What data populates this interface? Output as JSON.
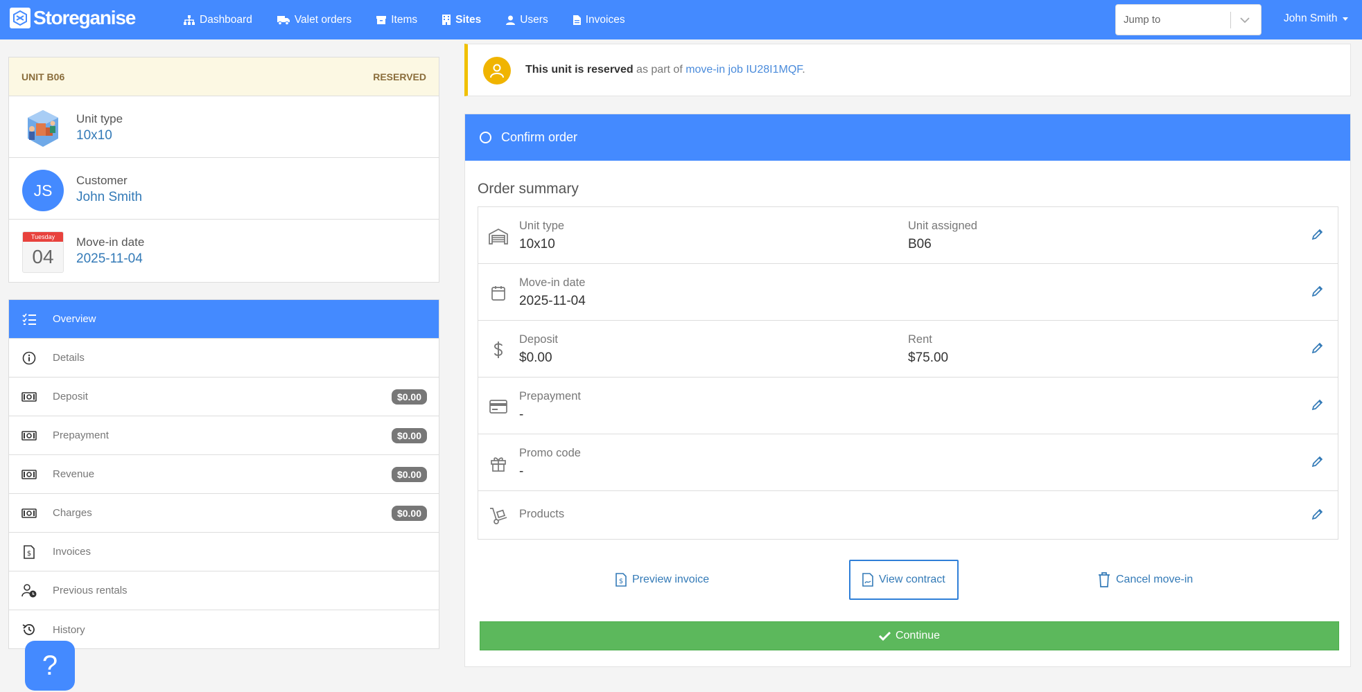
{
  "navbar": {
    "brand": "Storeganise",
    "links": [
      {
        "label": "Dashboard",
        "icon": "sitemap-icon"
      },
      {
        "label": "Valet orders",
        "icon": "truck-icon"
      },
      {
        "label": "Items",
        "icon": "archive-icon"
      },
      {
        "label": "Sites",
        "icon": "building-icon",
        "active": true
      },
      {
        "label": "Users",
        "icon": "user-icon"
      },
      {
        "label": "Invoices",
        "icon": "invoice-icon"
      }
    ],
    "jump_to": "Jump to",
    "user_name": "John Smith"
  },
  "unit_card": {
    "unit_label": "UNIT B06",
    "status": "RESERVED",
    "unit_type_label": "Unit type",
    "unit_type_value": "10x10",
    "customer_label": "Customer",
    "customer_initials": "JS",
    "customer_value": "John Smith",
    "move_in_label": "Move-in date",
    "move_in_value": "2025-11-04",
    "calendar_weekday": "Tuesday",
    "calendar_day": "04"
  },
  "side_menu": {
    "items": [
      {
        "label": "Overview",
        "icon": "checklist-icon",
        "active": true
      },
      {
        "label": "Details",
        "icon": "info-icon"
      },
      {
        "label": "Deposit",
        "icon": "money-icon",
        "badge": "$0.00"
      },
      {
        "label": "Prepayment",
        "icon": "money-icon",
        "badge": "$0.00"
      },
      {
        "label": "Revenue",
        "icon": "money-icon",
        "badge": "$0.00"
      },
      {
        "label": "Charges",
        "icon": "money-icon",
        "badge": "$0.00"
      },
      {
        "label": "Invoices",
        "icon": "invoice-icon"
      },
      {
        "label": "Previous rentals",
        "icon": "user-clock-icon"
      },
      {
        "label": "History",
        "icon": "history-icon"
      }
    ]
  },
  "help_button": "?",
  "alert": {
    "bold": "This unit is reserved",
    "text": " as part of ",
    "link": "move-in job IU28I1MQF",
    "suffix": "."
  },
  "order": {
    "step_title": "Confirm order",
    "summary_title": "Order summary",
    "rows": {
      "unit_type": {
        "label": "Unit type",
        "value": "10x10",
        "label2": "Unit assigned",
        "value2": "B06"
      },
      "move_in": {
        "label": "Move-in date",
        "value": "2025-11-04"
      },
      "deposit": {
        "label": "Deposit",
        "value": "$0.00",
        "label2": "Rent",
        "value2": "$75.00"
      },
      "prepayment": {
        "label": "Prepayment",
        "value": "-"
      },
      "promo": {
        "label": "Promo code",
        "value": "-"
      },
      "products": {
        "label": "Products"
      }
    },
    "actions": {
      "preview_invoice": "Preview invoice",
      "view_contract": "View contract",
      "cancel_move_in": "Cancel move-in"
    },
    "continue": "Continue"
  },
  "colors": {
    "primary": "#448aff",
    "link": "#337ab7",
    "success": "#5cb85c",
    "warning_border": "#f0c000",
    "reserved_bg": "#fcf8e3",
    "calendar_red": "#e8423d"
  }
}
